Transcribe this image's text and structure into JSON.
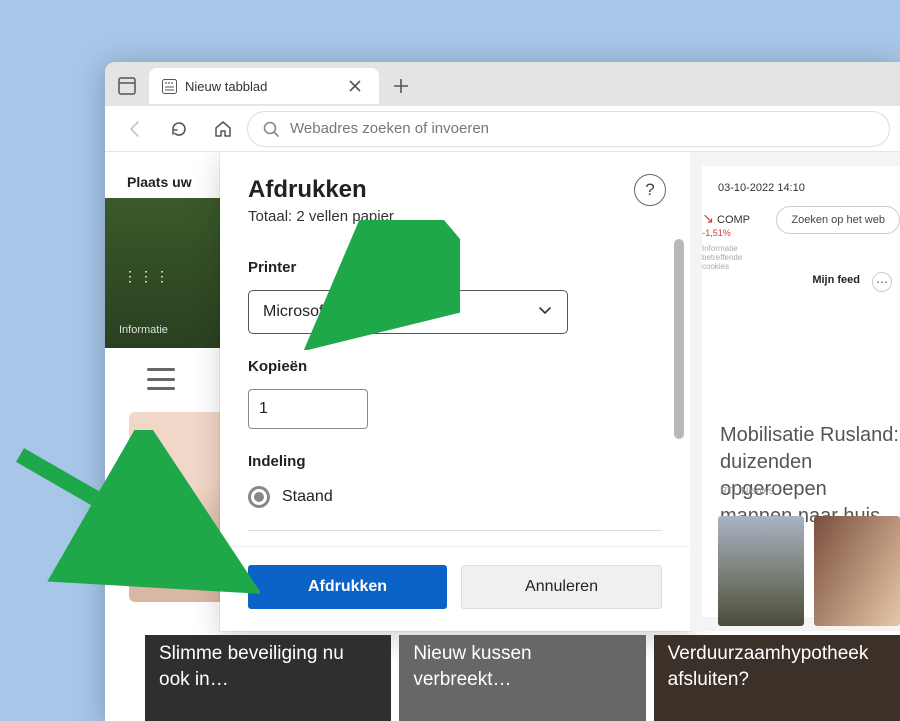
{
  "titlebar": {
    "tab_title": "Nieuw tabblad"
  },
  "toolbar": {
    "omnibox_placeholder": "Webadres zoeken of invoeren"
  },
  "ntp": {
    "top_text": "Plaats uw",
    "hero_info": "Informatie",
    "stories": [
      "Slimme beveiliging nu ook in…",
      "Nieuw kussen verbreekt…",
      "Verduurzaamhypotheek afsluiten?"
    ]
  },
  "print": {
    "title": "Afdrukken",
    "subtitle": "Totaal: 2 vellen papier",
    "help_char": "?",
    "printer_label": "Printer",
    "printer_value": "Microsoft Print to PDF",
    "copies_label": "Kopieën",
    "copies_value": "1",
    "layout_label": "Indeling",
    "layout_option": "Staand",
    "print_btn": "Afdrukken",
    "cancel_btn": "Annuleren"
  },
  "preview": {
    "date": "03-10-2022 14:10",
    "stock_symbol": "COMP",
    "stock_change": "-1,51%",
    "search_label": "Zoeken op het web",
    "cookies_label": "Informatie betreffende cookies",
    "feed_label": "Mijn feed",
    "headline": "Mobilisatie Rusland: duizenden opgeroepen mannen naar huis gestuurd",
    "source": "RTL Nieuws"
  }
}
